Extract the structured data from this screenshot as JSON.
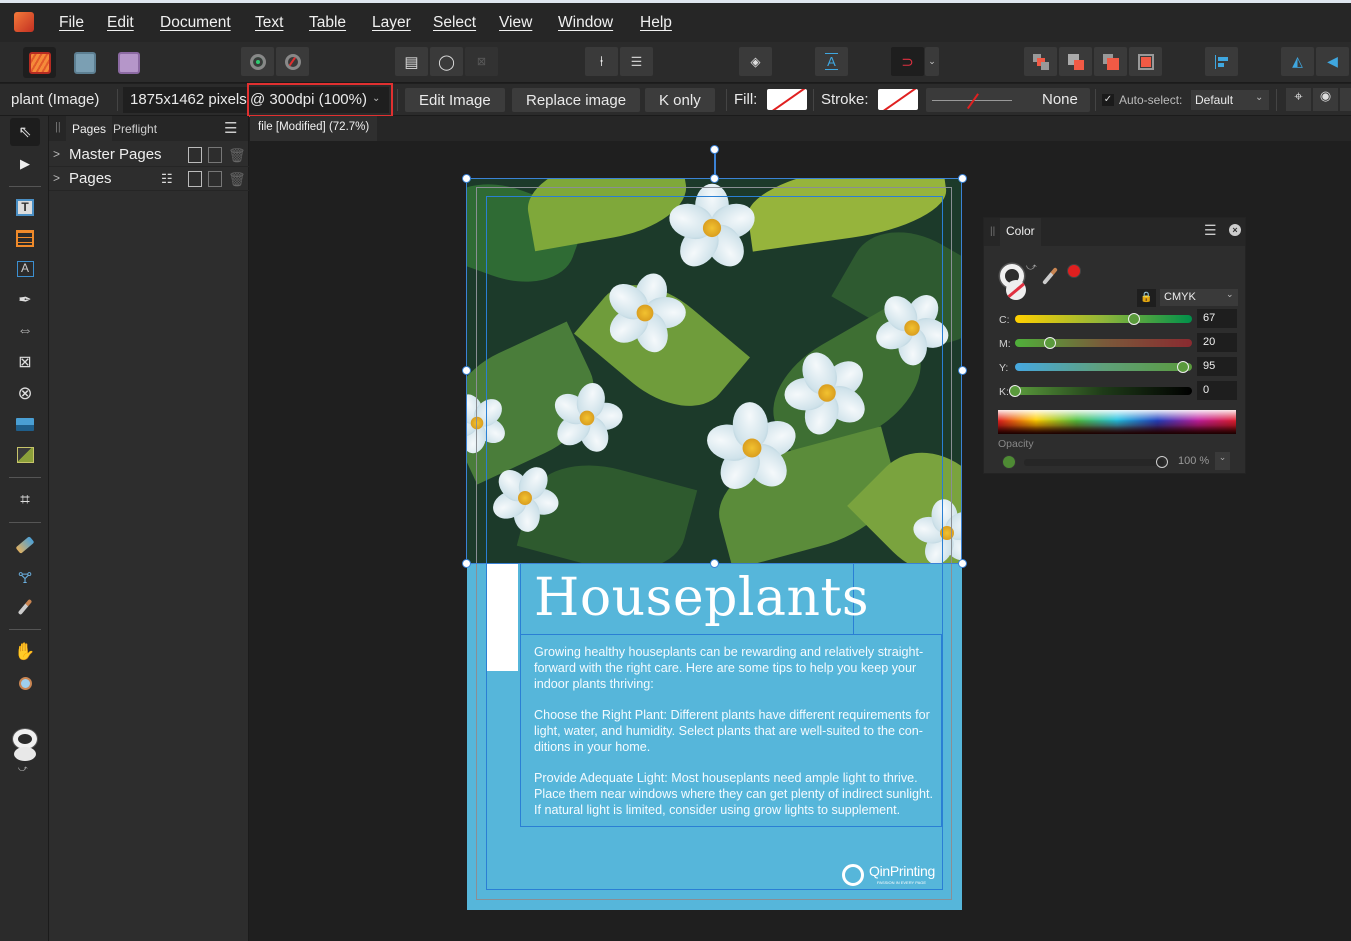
{
  "menubar": {
    "items": [
      "File",
      "Edit",
      "Document",
      "Text",
      "Table",
      "Layer",
      "Select",
      "View",
      "Window",
      "Help"
    ]
  },
  "toolbar": {
    "personas": [
      "publisher-persona",
      "designer-persona",
      "photo-persona"
    ],
    "buttons": [
      "preflight-ok",
      "preflight-off",
      "text-wrap-page",
      "text-wrap-shape",
      "text-wrap-none",
      "pin",
      "pin-settings",
      "show-text-frames",
      "snapping",
      "snapping-options",
      "move-back",
      "move-forward-one",
      "move-back-one",
      "move-front",
      "align",
      "flip-horizontal",
      "flip-vertical"
    ]
  },
  "context": {
    "object_label": "plant (Image)",
    "dimensions": "1875x1462 pixels",
    "resolution": "@ 300dpi (100%)",
    "edit_image": "Edit Image",
    "replace_image": "Replace image",
    "k_only": "K only",
    "fill_label": "Fill:",
    "stroke_label": "Stroke:",
    "stroke_style": "None",
    "auto_select_label": "Auto-select:",
    "auto_select_checked": true,
    "auto_select_value": "Default",
    "highlight_color": "#e03030"
  },
  "pages_panel": {
    "tabs": [
      "Pages",
      "Preflight"
    ],
    "active_tab": "Pages",
    "sections": [
      {
        "label": "Master Pages"
      },
      {
        "label": "Pages"
      }
    ]
  },
  "document": {
    "tab_title": "file [Modified] (72.7%)",
    "title": "Houseplants",
    "paragraphs": [
      "Growing healthy houseplants can be rewarding and relatively straight-forward with the right care. Here are some tips to help you keep your indoor plants thriving:",
      "Choose the Right Plant: Different plants have different requirements for light, water, and humidity. Select plants that are well-suited to the con-ditions in your home.",
      "Provide Adequate Light: Most houseplants need ample light to thrive. Place them near windows where they can get plenty of indirect sunlight. If natural light is limited, consider using grow lights to supplement."
    ],
    "logo_name": "QinPrinting",
    "logo_tagline": "PASSION IN EVERY PAGE",
    "background_color": "#56b6da"
  },
  "color_panel": {
    "title": "Color",
    "model": "CMYK",
    "sliders": [
      {
        "label": "C:",
        "value": "67",
        "fraction": 0.67
      },
      {
        "label": "M:",
        "value": "20",
        "fraction": 0.2
      },
      {
        "label": "Y:",
        "value": "95",
        "fraction": 0.95
      },
      {
        "label": "K:",
        "value": "0",
        "fraction": 0.0
      }
    ],
    "opacity_label": "Opacity",
    "opacity_value": "100 %",
    "current_color": "#4e8a34",
    "picker_color": "#e01f1f"
  }
}
